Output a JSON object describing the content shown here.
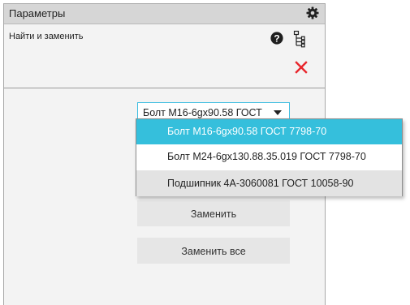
{
  "panel": {
    "title": "Параметры",
    "subtitle": "Найти и заменить",
    "icons": [
      "gear-icon",
      "help-icon",
      "tree-icon",
      "close-icon"
    ]
  },
  "select": {
    "value": "Болт М16-6gx90.58 ГОСТ 7798-70",
    "options": [
      "Болт М16-6gx90.58 ГОСТ 7798-70",
      "Болт М24-6gx130.88.35.019 ГОСТ 7798-70",
      "Подшипник 4А-3060081 ГОСТ 10058-90"
    ]
  },
  "buttons": {
    "replace_label": "Заменить",
    "replace_all_label": "Заменить все"
  },
  "colors": {
    "accent": "#35bfdc",
    "close": "#e8262c",
    "titlebar": "#d6d6d6",
    "button": "#e6e6e6"
  }
}
